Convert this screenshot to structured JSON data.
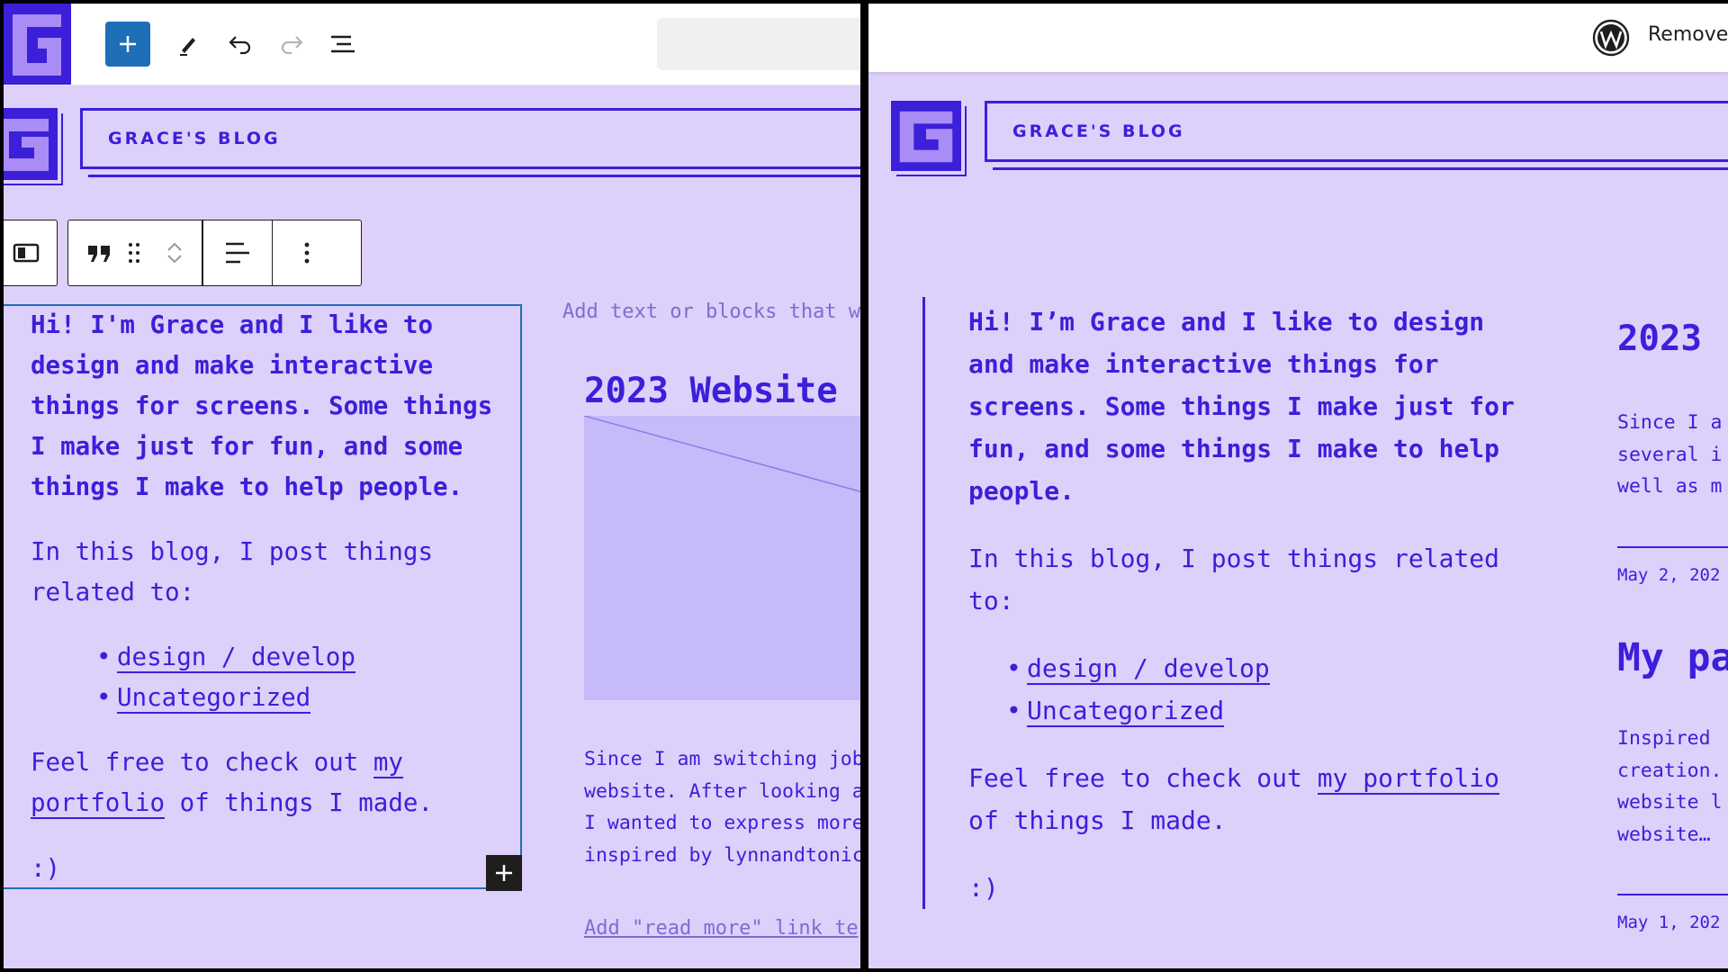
{
  "site": {
    "title": "GRACE'S BLOG"
  },
  "intro": "Hi! I’m Grace and I like to design and make interactive things for screens. Some things I make just for fun, and some things I make to help people.",
  "intro_left": "Hi! I'm Grace and I like to design and make interactive things for screens. Some things I make just for fun, and some things I make to help people.",
  "blog_line": "In this blog, I post things related to:",
  "categories": [
    "design / develop",
    "Uncategorized"
  ],
  "portfolio_line": {
    "before": "Feel free to check out ",
    "link": "my portfolio",
    "after": " of things I made."
  },
  "smiley": ":)",
  "editor": {
    "column_hint": "Add text or blocks that w",
    "post_title": "2023 Website",
    "excerpt_lines": [
      "Since I am switching job",
      "website. After looking a",
      "I wanted to express more",
      "inspired by lynnandtonic"
    ],
    "read_more": "Add \"read more\" link te"
  },
  "frontend": {
    "admin_remove": "Remove",
    "post1": {
      "title": "2023",
      "excerpt_lines": [
        "Since I a",
        "several i",
        "well as m"
      ],
      "date": "May 2, 202"
    },
    "post2": {
      "title": "My pa",
      "excerpt_lines": [
        "Inspired",
        "creation.",
        "website l",
        "website…"
      ],
      "date": "May 1, 202"
    }
  },
  "colors": {
    "brand": "#3b1fd9",
    "background": "#ddd0fb",
    "editor_accent": "#1e6fb8"
  },
  "icons": {
    "toolbar": [
      "site-icon",
      "plus-icon",
      "pen-icon",
      "undo-icon",
      "redo-icon",
      "list-view-icon"
    ],
    "block_toolbar": [
      "columns-icon",
      "quote-icon",
      "drag-handle-icon",
      "chevron-up-icon",
      "chevron-down-icon",
      "align-icon",
      "more-options-icon"
    ]
  }
}
